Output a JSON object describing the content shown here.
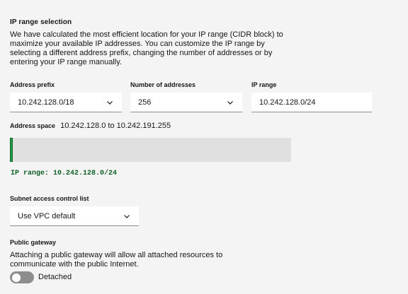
{
  "ip_range_section": {
    "title": "IP range selection",
    "description": "We have calculated the most efficient location for your IP range (CIDR block) to maximize your available IP addresses. You can customize the IP range by selecting a different address prefix, changing the number of addresses or by entering your IP range manually."
  },
  "address_prefix": {
    "label": "Address prefix",
    "value": "10.242.128.0/18"
  },
  "number_of_addresses": {
    "label": "Number of addresses",
    "value": "256"
  },
  "ip_range_input": {
    "label": "IP range",
    "value": "10.242.128.0/24"
  },
  "address_space": {
    "label": "Address space",
    "value": "10.242.128.0 to 10.242.191.255",
    "selected_fraction": 0.0039,
    "fill_color": "#24a148"
  },
  "ip_range_note": "IP range: 10.242.128.0/24",
  "subnet_acl": {
    "label": "Subnet access control list",
    "value": "Use VPC default"
  },
  "public_gateway": {
    "title": "Public gateway",
    "description": "Attaching a public gateway will allow all attached resources to communicate with the public Internet.",
    "toggle_state": "Detached",
    "toggle_on": false
  },
  "icons": {
    "dropdown": "chevron-down-icon"
  }
}
